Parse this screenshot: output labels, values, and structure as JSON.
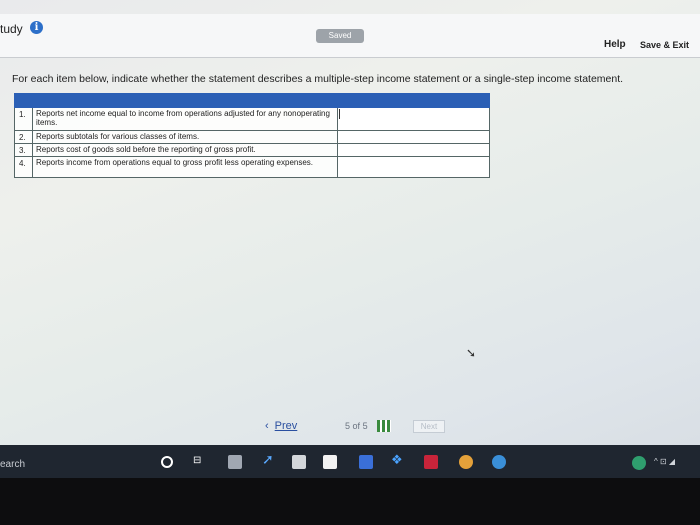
{
  "header": {
    "app_title": "tudy",
    "saved_label": "Saved",
    "help_label": "Help",
    "save_exit_label": "Save & Exit"
  },
  "instructions": "For each item below, indicate whether the statement describes a multiple-step income statement or a single-step income statement.",
  "questions": [
    {
      "num": "1.",
      "text": "Reports net income equal to income from operations adjusted for any nonoperating items."
    },
    {
      "num": "2.",
      "text": "Reports subtotals for various classes of items."
    },
    {
      "num": "3.",
      "text": "Reports cost of goods sold before the reporting of gross profit."
    },
    {
      "num": "4.",
      "text": "Reports income from operations equal to gross profit less operating expenses."
    }
  ],
  "pager": {
    "prev_label": "Prev",
    "current": "5",
    "of_label": "of",
    "total": "5",
    "next_label": "Next"
  },
  "taskbar": {
    "search_label": "earch",
    "taskview_glyph": "⊟",
    "app2_glyph": "➚",
    "app6_glyph": "❖",
    "tray_glyph": "^ ⊡ ◢"
  },
  "icons": {
    "info": "info-icon",
    "grid": "grid-icon",
    "cursor": "cursor-icon"
  },
  "colors": {
    "accent": "#2b5fb5",
    "saved_badge": "#9da3a9",
    "link": "#2a4fa0",
    "taskbar": "#1f2630"
  }
}
